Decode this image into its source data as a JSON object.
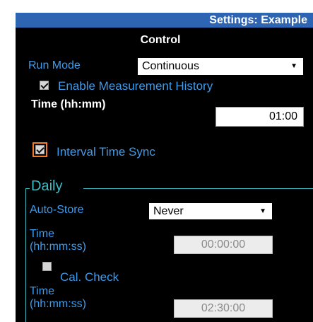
{
  "header": {
    "title": "Settings: Example"
  },
  "section": {
    "title": "Control"
  },
  "run_mode": {
    "label": "Run Mode",
    "value": "Continuous",
    "arrow": "▼"
  },
  "measurement_history": {
    "label": "Enable Measurement History",
    "checked": true
  },
  "history_time": {
    "label": "Time (hh:mm)",
    "value": "01:00"
  },
  "interval_sync": {
    "label": "Interval Time Sync",
    "checked": true
  },
  "daily": {
    "legend": "Daily",
    "auto_store": {
      "label": "Auto-Store",
      "value": "Never",
      "arrow": "▼"
    },
    "time1": {
      "label_line1": "Time",
      "label_line2": "(hh:mm:ss)",
      "value": "00:00:00"
    },
    "cal_check": {
      "label": "Cal. Check",
      "checked": false
    },
    "time2": {
      "label_line1": "Time",
      "label_line2": "(hh:mm:ss)",
      "value": "02:30:00"
    }
  },
  "colors": {
    "header_bg": "#2e65b3",
    "label_blue": "#3f9bea",
    "fieldset_teal": "#3fbcc4",
    "focus_orange": "#f07c2a"
  }
}
